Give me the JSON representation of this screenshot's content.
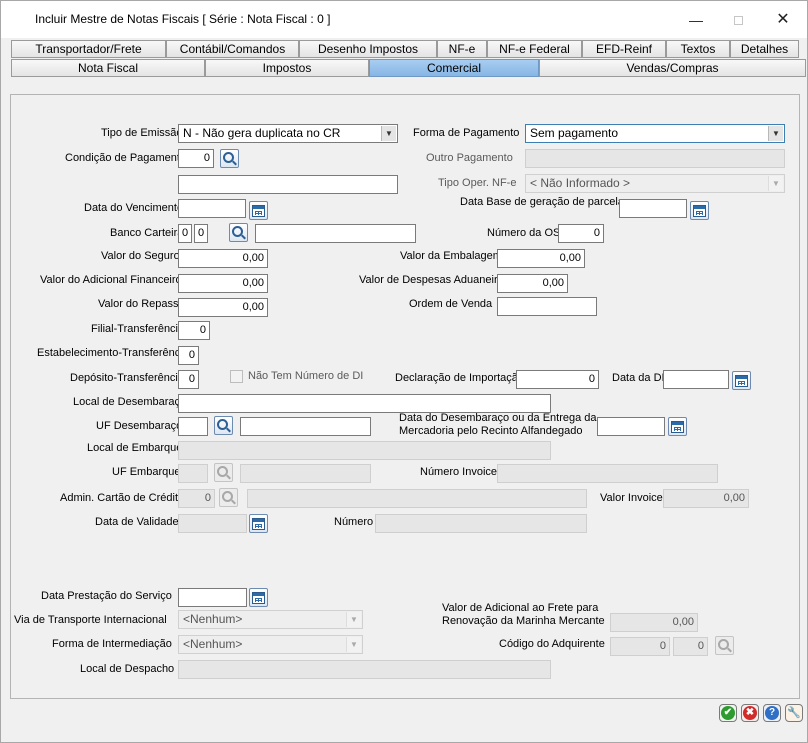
{
  "window": {
    "title": "Incluir Mestre de Notas Fiscais [ Série :    Nota Fiscal : 0 ]",
    "min_glyph": "—",
    "close_glyph": "✕"
  },
  "tabs_row1": [
    "Transportador/Frete",
    "Contábil/Comandos",
    "Desenho Impostos",
    "NF-e",
    "NF-e Federal",
    "EFD-Reinf",
    "Textos",
    "Detalhes"
  ],
  "tabs_row2": [
    "Nota Fiscal",
    "Impostos",
    "Comercial",
    "Vendas/Compras"
  ],
  "active_tab": "Comercial",
  "form": {
    "tipo_emissao": {
      "label": "Tipo de Emissão",
      "value": "N - Não gera duplicata no CR"
    },
    "forma_pagamento": {
      "label": "Forma de Pagamento",
      "value": "Sem pagamento"
    },
    "condicao_pagamento": {
      "label": "Condição de Pagamento",
      "value": "0",
      "desc": ""
    },
    "outro_pagamento": {
      "label": "Outro Pagamento",
      "value": ""
    },
    "tipo_oper_nfe": {
      "label": "Tipo Oper. NF-e",
      "value": "< Não Informado >"
    },
    "data_vencimento": {
      "label": "Data do Vencimento",
      "value": ""
    },
    "data_base_parcelas": {
      "label": "Data Base de geração de parcelas",
      "value": ""
    },
    "banco_carteira": {
      "label": "Banco Carteira",
      "banco": "0",
      "carteira": "0",
      "desc": ""
    },
    "numero_os": {
      "label": "Número da OS",
      "value": "0"
    },
    "valor_seguro": {
      "label": "Valor do Seguro",
      "value": "0,00"
    },
    "valor_embalagem": {
      "label": "Valor da Embalagem",
      "value": "0,00"
    },
    "valor_adic_financeiro": {
      "label": "Valor do Adicional Financeiro",
      "value": "0,00"
    },
    "valor_desp_aduaneiras": {
      "label": "Valor de Despesas Aduaneiras",
      "value": "0,00"
    },
    "valor_repasse": {
      "label": "Valor do Repasse",
      "value": "0,00"
    },
    "ordem_venda": {
      "label": "Ordem de Venda",
      "value": ""
    },
    "filial_transferencia": {
      "label": "Filial-Transferência",
      "value": "0"
    },
    "estab_transferencia": {
      "label": "Estabelecimento-Transferência",
      "value": "0"
    },
    "deposito_transferencia": {
      "label": "Depósito-Transferência",
      "value": "0"
    },
    "nao_tem_di": {
      "label": "Não Tem Número de DI",
      "checked": false
    },
    "declaracao_importacao": {
      "label": "Declaração de Importação",
      "value": "0"
    },
    "data_di": {
      "label": "Data da DI",
      "value": ""
    },
    "local_desembaraco": {
      "label": "Local de Desembaraço",
      "value": ""
    },
    "uf_desembaraco": {
      "label": "UF Desembaraço",
      "uf": "",
      "desc": ""
    },
    "data_desembaraco": {
      "label_line1": "Data do Desembaraço ou da Entrega da",
      "label_line2": "Mercadoria pelo Recinto Alfandegado",
      "value": ""
    },
    "local_embarque": {
      "label": "Local de Embarque",
      "value": ""
    },
    "uf_embarque": {
      "label": "UF Embarque",
      "uf": "",
      "desc": ""
    },
    "numero_invoice": {
      "label": "Número Invoice",
      "value": ""
    },
    "admin_cartao": {
      "label": "Admin. Cartão de Crédito",
      "value": "0",
      "desc": ""
    },
    "valor_invoice": {
      "label": "Valor Invoice",
      "value": "0,00"
    },
    "data_validade": {
      "label": "Data de Validade",
      "value": ""
    },
    "numero": {
      "label": "Número",
      "value": ""
    },
    "data_prestacao": {
      "label": "Data Prestação do Serviço",
      "value": ""
    },
    "via_transporte": {
      "label": "Via de Transporte Internacional",
      "value": "<Nenhum>"
    },
    "valor_adic_frete": {
      "label_line1": "Valor de Adicional ao Frete para",
      "label_line2": "Renovação da Marinha Mercante",
      "value": "0,00"
    },
    "forma_intermediacao": {
      "label": "Forma de Intermediação",
      "value": "<Nenhum>"
    },
    "codigo_adquirente": {
      "label": "Código do Adquirente",
      "value1": "0",
      "value2": "0"
    },
    "local_despacho": {
      "label": "Local de Despacho",
      "value": ""
    }
  },
  "actions": {
    "ok_glyph": "✔",
    "cancel_glyph": "✖",
    "help_glyph": "?",
    "tools_glyph": "🔧"
  },
  "colors": {
    "ok": "#2e9b2e",
    "cancel": "#d02a2a",
    "help": "#2f6fc6",
    "tools": "#e07a10",
    "active_tab": "#93bfea"
  }
}
